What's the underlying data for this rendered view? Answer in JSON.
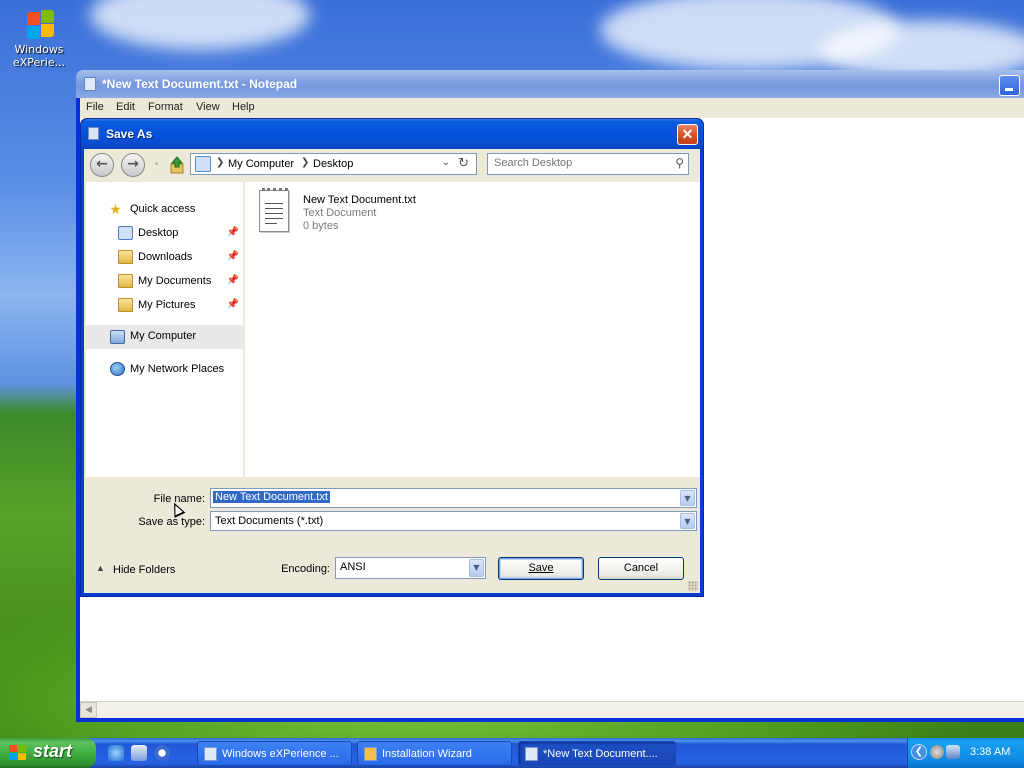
{
  "desktop": {
    "icon_label": "Windows eXPerie..."
  },
  "notepad": {
    "title": "*New Text Document.txt - Notepad",
    "menus": [
      "File",
      "Edit",
      "Format",
      "View",
      "Help"
    ]
  },
  "dialog": {
    "title": "Save As",
    "close_label": "✕",
    "address": {
      "crumbs": [
        "My Computer",
        "Desktop"
      ],
      "search_placeholder": "Search Desktop"
    },
    "nav": {
      "quick_access": "Quick access",
      "items": [
        {
          "label": "Desktop",
          "pinned": true
        },
        {
          "label": "Downloads",
          "pinned": true
        },
        {
          "label": "My Documents",
          "pinned": true
        },
        {
          "label": "My Pictures",
          "pinned": true
        }
      ],
      "my_computer": "My Computer",
      "network": "My Network Places"
    },
    "file": {
      "name": "New Text Document.txt",
      "type": "Text Document",
      "size": "0 bytes"
    },
    "form": {
      "file_name_label": "File name:",
      "file_name_value": "New Text Document.txt",
      "save_type_label": "Save as type:",
      "save_type_value": "Text Documents (*.txt)",
      "encoding_label": "Encoding:",
      "encoding_value": "ANSI",
      "hide_folders": "Hide Folders",
      "save_button": "Save",
      "cancel_button": "Cancel"
    }
  },
  "taskbar": {
    "start_label": "start",
    "tasks": [
      {
        "label": "Windows eXPerience ...",
        "active": false
      },
      {
        "label": "Installation Wizard",
        "active": false
      },
      {
        "label": "*New Text Document....",
        "active": true
      }
    ],
    "clock": "3:38 AM"
  },
  "colors": {
    "xp_blue_title": "#0653d9",
    "start_green": "#3fae3f",
    "selection_blue": "#316ac5",
    "dialog_face": "#ece9d8"
  }
}
